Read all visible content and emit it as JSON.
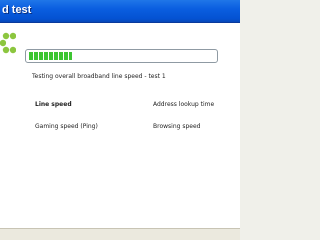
{
  "window": {
    "title": "d test",
    "progress_fraction": 0.23
  },
  "status": {
    "text": "Testing overall broadband line speed  -  test 1"
  },
  "metrics": {
    "line_speed": "Line speed",
    "address_lookup_time": "Address lookup time",
    "gaming_speed": "Gaming speed (Ping)",
    "browsing_speed": "Browsing speed"
  },
  "icons": {
    "logo": "green-flower-logo-icon"
  },
  "colors": {
    "titlebar": "#0a5ee0",
    "progress_fill": "#3dc532",
    "logo": "#8cc63f"
  }
}
